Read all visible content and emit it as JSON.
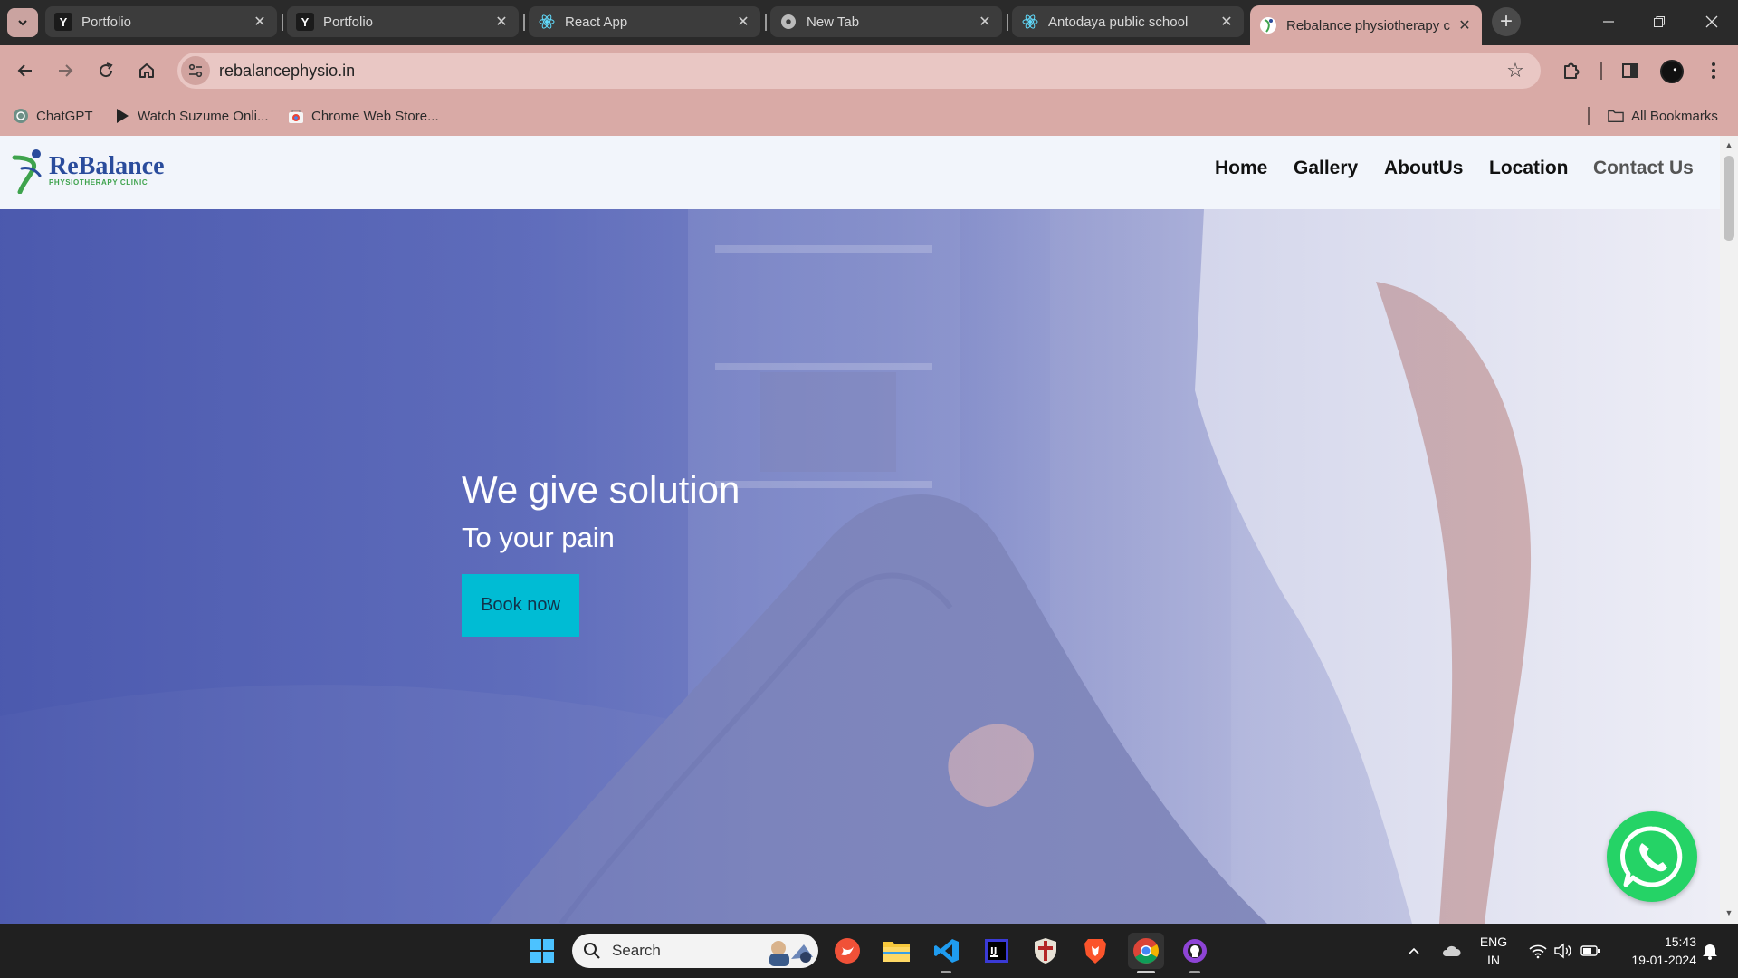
{
  "browser": {
    "tabs": [
      {
        "title": "Portfolio",
        "favicon": "Y"
      },
      {
        "title": "Portfolio",
        "favicon": "Y"
      },
      {
        "title": "React App",
        "favicon": "react-icon"
      },
      {
        "title": "New Tab",
        "favicon": "chrome-icon"
      },
      {
        "title": "Antodaya public school",
        "favicon": "react-icon"
      },
      {
        "title": "Rebalance physiotherapy c",
        "favicon": "rebalance-icon",
        "active": true
      }
    ],
    "url": "rebalancephysio.in",
    "bookmarks": [
      {
        "label": "ChatGPT"
      },
      {
        "label": "Watch Suzume Onli..."
      },
      {
        "label": "Chrome Web Store..."
      }
    ],
    "all_bookmarks": "All Bookmarks",
    "frame_color": "#d9aaa6"
  },
  "site": {
    "logo": {
      "name": "ReBalance",
      "tagline": "PHYSIOTHERAPY CLINIC"
    },
    "nav": [
      "Home",
      "Gallery",
      "AboutUs",
      "Location",
      "Contact Us"
    ],
    "hero": {
      "title": "We give solution",
      "subtitle": "To your pain",
      "button": "Book now"
    },
    "accent": "#00bcd4"
  },
  "taskbar": {
    "search_label": "Search",
    "language": {
      "line1": "ENG",
      "line2": "IN"
    },
    "time": "15:43",
    "date": "19-01-2024"
  }
}
